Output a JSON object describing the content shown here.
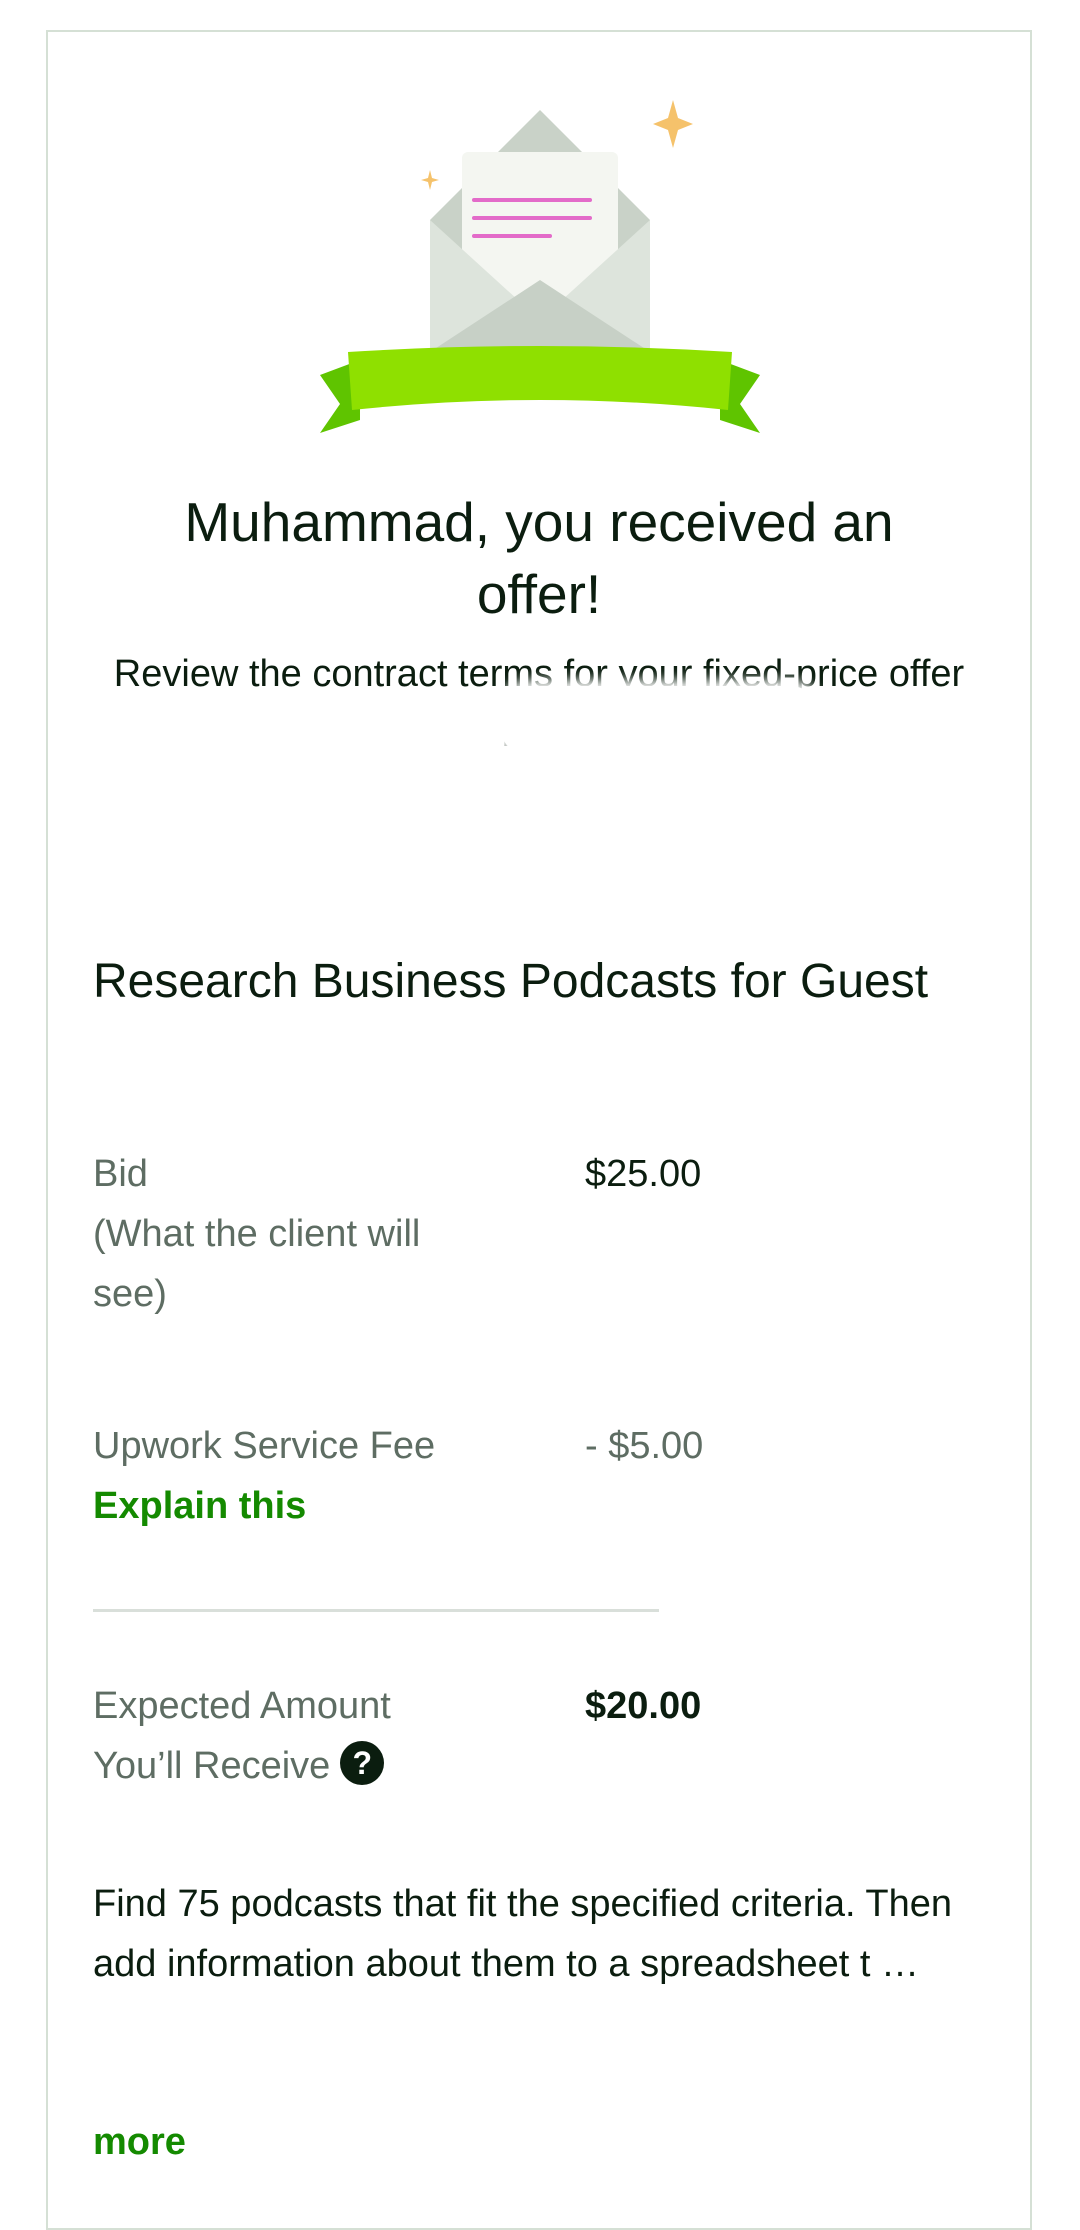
{
  "offer": {
    "headline": "Muhammad, you received an offer!",
    "subhead": "Review the contract terms for your fixed-price offer from"
  },
  "job": {
    "title": "Research Business Podcasts for Guest",
    "bid_label": "Bid",
    "bid_sublabel_line1": "(What the client will",
    "bid_sublabel_line2": "see)",
    "bid_value": "$25.00",
    "fee_label": "Upwork Service Fee",
    "fee_value": "- $5.00",
    "explain_link": "Explain this",
    "expected_label_line1": "Expected Amount",
    "expected_label_line2": "You’ll Receive",
    "expected_value": "$20.00",
    "description": "Find 75 podcasts that fit the specified criteria. Then add information about them to a spreadsheet t …",
    "more_link": "more"
  },
  "icons": {
    "hero": "open-envelope-with-ribbon-illustration",
    "help": "help-circle-icon"
  },
  "colors": {
    "brand_green": "#14a800",
    "link_green": "#148a00",
    "ribbon_green": "#8fe000",
    "text_dark": "#0b1d0f",
    "text_muted": "#5e6d63"
  }
}
